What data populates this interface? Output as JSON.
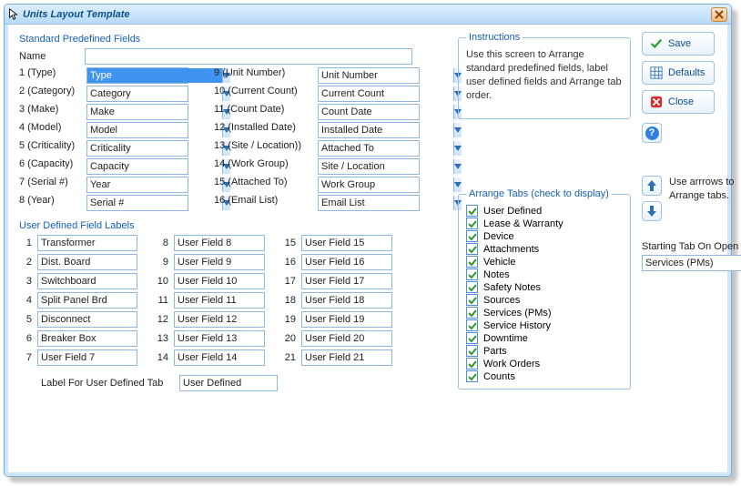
{
  "window": {
    "title": "Units Layout Template"
  },
  "sections": {
    "standard": "Standard Predefined Fields",
    "name_label": "Name",
    "udf": "User Defined Field Labels",
    "label_for_tab": "Label For User Defined Tab",
    "label_for_tab_value": "User Defined",
    "arrange_tabs": "Arrange Tabs (check to display)"
  },
  "std_left": [
    {
      "label": "1 (Type)",
      "value": "Type",
      "selected": true
    },
    {
      "label": "2 (Category)",
      "value": "Category"
    },
    {
      "label": "3 (Make)",
      "value": "Make"
    },
    {
      "label": "4 (Model)",
      "value": "Model"
    },
    {
      "label": "5 (Criticality)",
      "value": "Criticality"
    },
    {
      "label": "6 (Capacity)",
      "value": "Capacity"
    },
    {
      "label": "7 (Serial #)",
      "value": "Year"
    },
    {
      "label": "8 (Year)",
      "value": "Serial #"
    }
  ],
  "std_right": [
    {
      "label": "9 (Unit Number)",
      "value": "Unit Number"
    },
    {
      "label": "10 (Current Count)",
      "value": "Current Count"
    },
    {
      "label": "11 (Count Date)",
      "value": "Count Date"
    },
    {
      "label": "12 (Installed Date)",
      "value": "Installed Date"
    },
    {
      "label": "13 (Site / Location))",
      "value": "Attached To"
    },
    {
      "label": "14 (Work Group)",
      "value": "Site / Location"
    },
    {
      "label": "15 (Attached To)",
      "value": "Work Group"
    },
    {
      "label": "16 (Email List)",
      "value": "Email List"
    }
  ],
  "udf": {
    "col1": [
      {
        "n": "1",
        "v": "Transformer"
      },
      {
        "n": "2",
        "v": "Dist. Board"
      },
      {
        "n": "3",
        "v": "Switchboard"
      },
      {
        "n": "4",
        "v": "Split Panel Brd"
      },
      {
        "n": "5",
        "v": "Disconnect"
      },
      {
        "n": "6",
        "v": "Breaker Box"
      },
      {
        "n": "7",
        "v": "User Field 7"
      }
    ],
    "col2": [
      {
        "n": "8",
        "v": "User Field 8"
      },
      {
        "n": "9",
        "v": "User Field 9"
      },
      {
        "n": "10",
        "v": "User Field 10"
      },
      {
        "n": "11",
        "v": "User Field 11"
      },
      {
        "n": "12",
        "v": "User Field 12"
      },
      {
        "n": "13",
        "v": "User Field 13"
      },
      {
        "n": "14",
        "v": "User Field 14"
      }
    ],
    "col3": [
      {
        "n": "15",
        "v": "User Field 15"
      },
      {
        "n": "16",
        "v": "User Field 16"
      },
      {
        "n": "17",
        "v": "User Field 17"
      },
      {
        "n": "18",
        "v": "User Field 18"
      },
      {
        "n": "19",
        "v": "User Field 19"
      },
      {
        "n": "20",
        "v": "User Field 20"
      },
      {
        "n": "21",
        "v": "User Field 21"
      }
    ]
  },
  "instructions": {
    "title": "Instructions",
    "text": "Use this screen to Arrange standard predefined fields, label user defined fields and Arrange tab order."
  },
  "buttons": {
    "save": "Save",
    "defaults": "Defaults",
    "close": "Close"
  },
  "tabs": [
    {
      "label": "User Defined",
      "checked": true
    },
    {
      "label": "Lease & Warranty",
      "checked": true
    },
    {
      "label": "Device",
      "checked": true
    },
    {
      "label": "Attachments",
      "checked": true
    },
    {
      "label": "Vehicle",
      "checked": true
    },
    {
      "label": "Notes",
      "checked": true
    },
    {
      "label": "Safety Notes",
      "checked": true
    },
    {
      "label": "Sources",
      "checked": true
    },
    {
      "label": "Services (PMs)",
      "checked": true
    },
    {
      "label": "Service History",
      "checked": true
    },
    {
      "label": "Downtime",
      "checked": true
    },
    {
      "label": "Parts",
      "checked": true
    },
    {
      "label": "Work Orders",
      "checked": true
    },
    {
      "label": "Counts",
      "checked": true
    }
  ],
  "arrows_text": "Use arrrows to Arrange tabs.",
  "starting_tab": {
    "label": "Starting Tab On Open",
    "value": "Services (PMs)"
  }
}
